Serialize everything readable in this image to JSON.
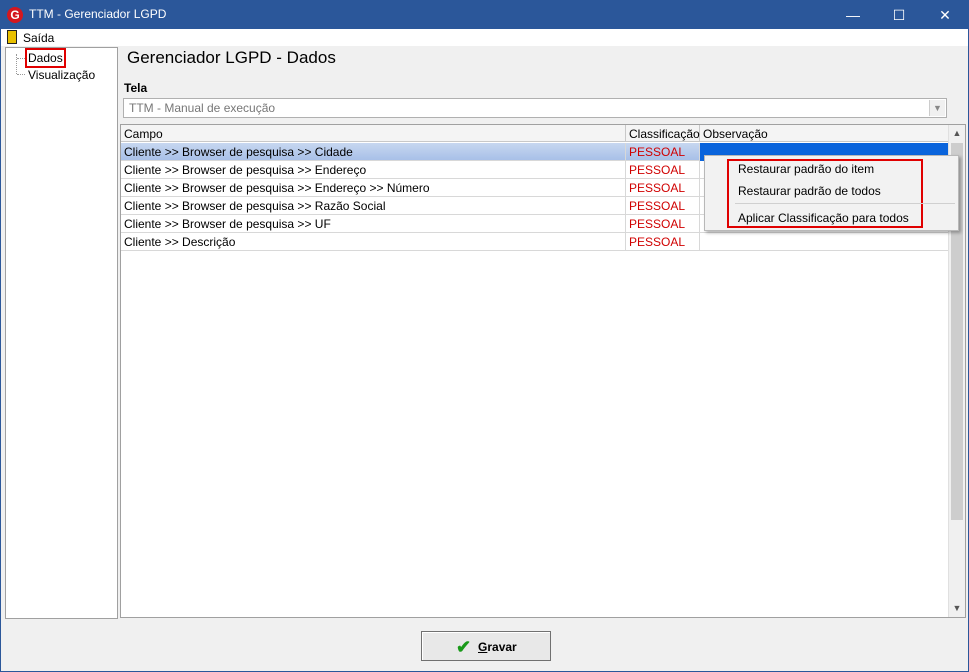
{
  "window": {
    "title": "TTM - Gerenciador LGPD",
    "app_icon": "G"
  },
  "titlebar_buttons": {
    "minimize": "—",
    "maximize": "☐",
    "close": "✕"
  },
  "menubar": {
    "exit_label": "Saída",
    "exit_icon": "door-exit-icon"
  },
  "tree": {
    "items": [
      {
        "label": "Dados",
        "selected": true
      },
      {
        "label": "Visualização",
        "selected": false
      }
    ]
  },
  "page": {
    "heading": "Gerenciador LGPD - Dados",
    "tela_label": "Tela"
  },
  "tela_select": {
    "value": "TTM - Manual de execução",
    "arrow": "▼"
  },
  "grid": {
    "columns": [
      "Campo",
      "Classificação",
      "Observação"
    ],
    "rows": [
      {
        "campo": "Cliente >> Browser de pesquisa >> Cidade",
        "classificacao": "PESSOAL",
        "observacao": ""
      },
      {
        "campo": "Cliente >> Browser de pesquisa >> Endereço",
        "classificacao": "PESSOAL",
        "observacao": ""
      },
      {
        "campo": "Cliente >> Browser de pesquisa >> Endereço >> Número",
        "classificacao": "PESSOAL",
        "observacao": ""
      },
      {
        "campo": "Cliente >> Browser de pesquisa >> Razão Social",
        "classificacao": "PESSOAL",
        "observacao": ""
      },
      {
        "campo": "Cliente >> Browser de pesquisa >> UF",
        "classificacao": "PESSOAL",
        "observacao": ""
      },
      {
        "campo": "Cliente >> Descrição",
        "classificacao": "PESSOAL",
        "observacao": ""
      }
    ],
    "selected_row": 0,
    "scroll_up": "▲",
    "scroll_down": "▼"
  },
  "context_menu": {
    "items": [
      "Restaurar padrão do item",
      "Restaurar padrão de todos",
      "Aplicar Classificação para todos"
    ]
  },
  "save_button": {
    "label_underlined": "G",
    "label_rest": "ravar",
    "icon": "checkmark-icon"
  },
  "colors": {
    "titlebar": "#2b579a",
    "classification": "#d00000",
    "highlight_box": "#e00000",
    "selection": "#0a64dc"
  }
}
